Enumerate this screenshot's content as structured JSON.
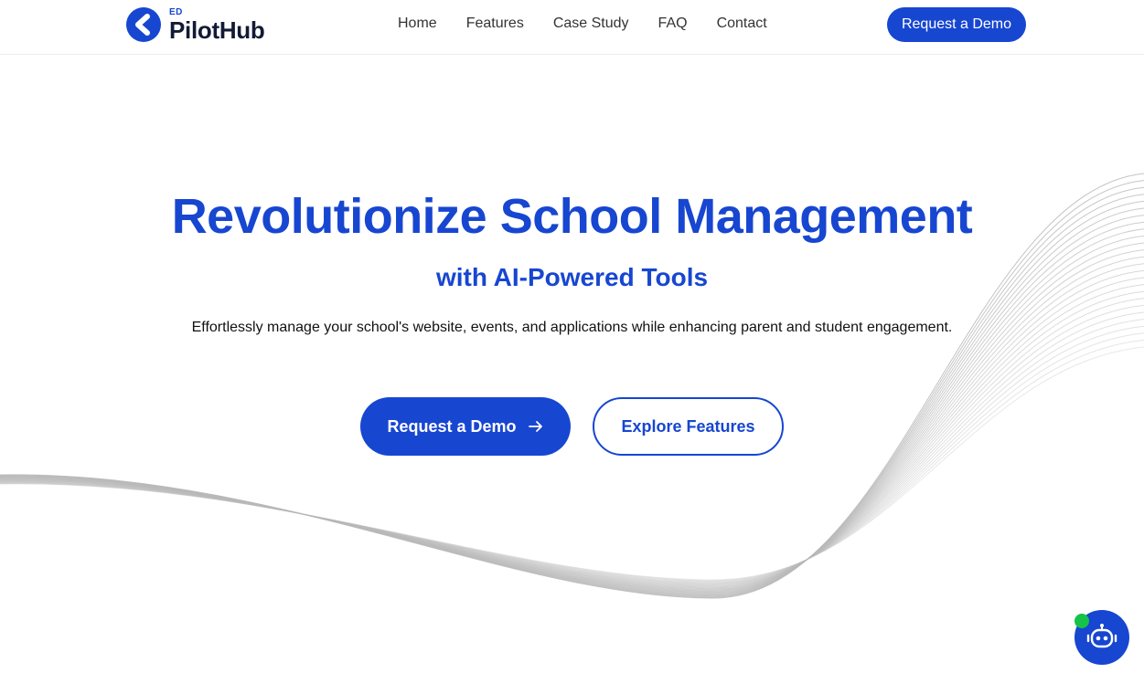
{
  "brand": {
    "prefix": "ED",
    "name": "PilotHub",
    "accent_color": "#1746d1"
  },
  "nav": {
    "links": [
      "Home",
      "Features",
      "Case Study",
      "FAQ",
      "Contact"
    ],
    "cta_label": "Request a Demo"
  },
  "hero": {
    "title": "Revolutionize School Management",
    "subtitle": "with AI-Powered Tools",
    "description": "Effortlessly manage your school's website, events, and applications while enhancing parent and student engagement.",
    "primary_button": "Request a Demo",
    "primary_button_icon": "arrow-right-icon",
    "secondary_button": "Explore Features"
  },
  "chat_widget": {
    "icon": "robot-icon",
    "status_color": "#16c24a"
  }
}
